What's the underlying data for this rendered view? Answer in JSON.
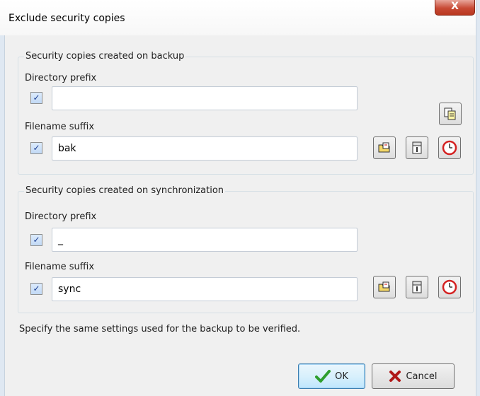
{
  "window": {
    "title": "Exclude security copies",
    "close_glyph": "X"
  },
  "backup_group": {
    "title": "Security copies created on backup",
    "dir_prefix_label": "Directory prefix",
    "dir_prefix_value": "",
    "dir_prefix_checked": true,
    "suffix_label": "Filename suffix",
    "suffix_value": "bak",
    "suffix_checked": true
  },
  "sync_group": {
    "title": "Security copies created on synchronization",
    "dir_prefix_label": "Directory prefix",
    "dir_prefix_value": "_",
    "dir_prefix_checked": true,
    "suffix_label": "Filename suffix",
    "suffix_value": "sync",
    "suffix_checked": true
  },
  "hint": "Specify the same settings used for the backup to be verified.",
  "buttons": {
    "ok": "OK",
    "cancel": "Cancel"
  },
  "icons": {
    "copy": "copy-icon",
    "folder_date": "folder-date-icon",
    "calendar": "calendar-icon",
    "clock": "clock-icon",
    "check": "checkmark-icon",
    "cancel_x": "cancel-x-icon"
  },
  "colors": {
    "ok_check": "#2e9e2e",
    "cancel_x": "#b01818",
    "clock_red": "#d42020",
    "close_red": "#c84a35"
  }
}
